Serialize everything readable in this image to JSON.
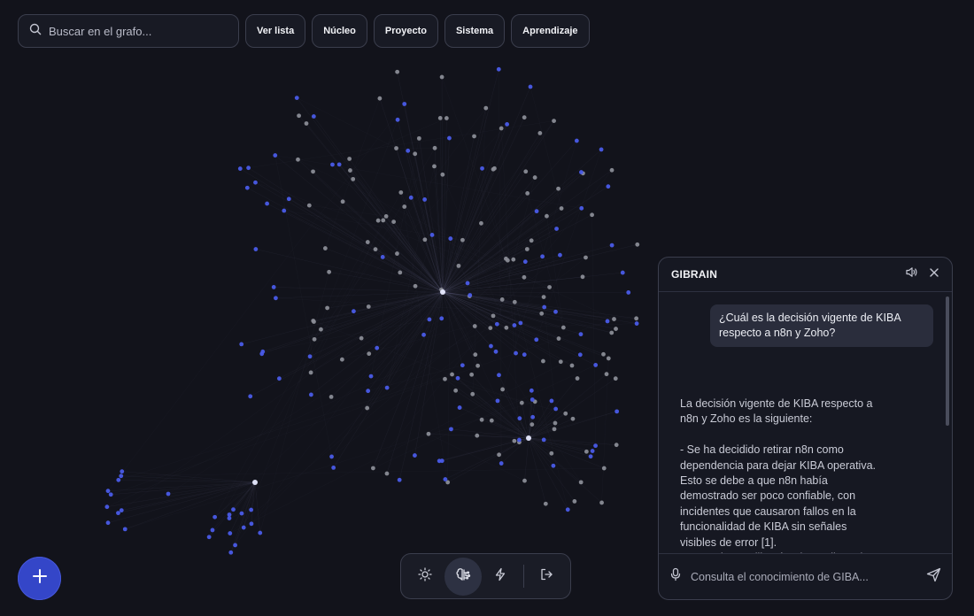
{
  "search": {
    "placeholder": "Buscar en el grafo..."
  },
  "filters": [
    {
      "label": "Ver lista"
    },
    {
      "label": "Núcleo"
    },
    {
      "label": "Proyecto"
    },
    {
      "label": "Sistema"
    },
    {
      "label": "Aprendizaje"
    }
  ],
  "chat": {
    "title": "GIBRAIN",
    "user_message": "¿Cuál es la decisión vigente de KIBA respecto a n8n y Zoho?",
    "assistant_message": "La decisión vigente de KIBA respecto a n8n y Zoho es la siguiente:\n\n- Se ha decidido retirar n8n como dependencia para dejar KIBA operativa. Esto se debe a que n8n había demostrado ser poco confiable, con incidentes que causaron fallos en la funcionalidad de KIBA sin señales visibles de error [1].\n- KIBA ahora utilizará Zoho Mail y Zoho Calendar mediante OAuth y sus APIs REST oficiales, conectando",
    "input_placeholder": "Consulta el conocimiento de GIBA..."
  },
  "icons": {
    "search": "search-icon",
    "add": "plus-icon",
    "theme": "sun-icon",
    "brain": "brain-icon",
    "activity": "lightning-icon",
    "logout": "logout-icon",
    "speaker": "speaker-icon",
    "close": "close-icon",
    "mic": "microphone-icon",
    "send": "send-icon"
  },
  "colors": {
    "background": "#12131b",
    "node_blue": "#4a5be8",
    "node_gray": "#8a8c96",
    "accent": "#3446c8"
  }
}
